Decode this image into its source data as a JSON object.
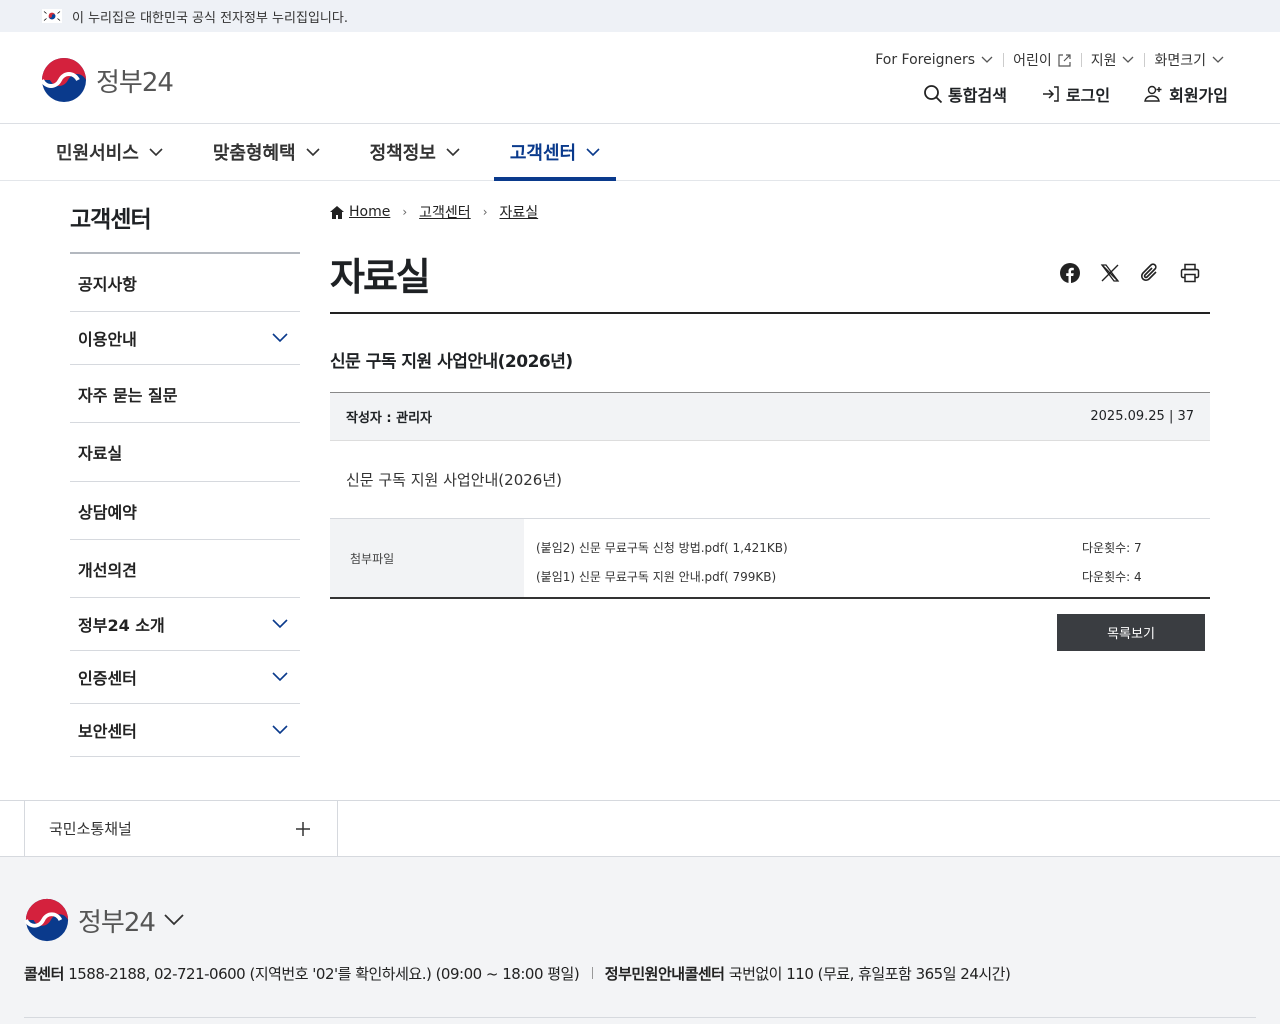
{
  "topbar": {
    "notice": "이 누리집은 대한민국 공식 전자정부 누리집입니다."
  },
  "header": {
    "logo_text": "정부24",
    "util": [
      "For Foreigners",
      "어린이",
      "지원",
      "화면크기"
    ],
    "actions": [
      {
        "label": "통합검색",
        "icon": "search-icon"
      },
      {
        "label": "로그인",
        "icon": "login-icon"
      },
      {
        "label": "회원가입",
        "icon": "user-add-icon"
      }
    ]
  },
  "gnb": [
    "민원서비스",
    "맞춤형혜택",
    "정책정보",
    "고객센터"
  ],
  "lnb": {
    "title": "고객센터",
    "items": [
      {
        "label": "공지사항",
        "expandable": false
      },
      {
        "label": "이용안내",
        "expandable": true
      },
      {
        "label": "자주 묻는 질문",
        "expandable": false
      },
      {
        "label": "자료실",
        "expandable": false
      },
      {
        "label": "상담예약",
        "expandable": false
      },
      {
        "label": "개선의견",
        "expandable": false
      },
      {
        "label": "정부24 소개",
        "expandable": true
      },
      {
        "label": "인증센터",
        "expandable": true
      },
      {
        "label": "보안센터",
        "expandable": true
      }
    ]
  },
  "breadcrumb": [
    "Home",
    "고객센터",
    "자료실"
  ],
  "page_title": "자료실",
  "post": {
    "title": "신문 구독 지원 사업안내(2026년)",
    "author": "작성자 : 관리자",
    "date_views": "2025.09.25 | 37",
    "content": "신문 구독 지원 사업안내(2026년)",
    "attach_label": "첨부파일",
    "files": [
      {
        "name": "(붙임2) 신문 무료구독 신청 방법.pdf( 1,421KB)",
        "downloads": "다운횟수: 7"
      },
      {
        "name": "(붙임1) 신문 무료구독 지원 안내.pdf( 799KB)",
        "downloads": "다운횟수: 4"
      }
    ],
    "list_button": "목록보기"
  },
  "footer": {
    "channel": "국민소통채널",
    "logo_text": "정부24",
    "call_label": "콜센터",
    "call_info": "1588-2188, 02-721-0600 (지역번호 '02'를 확인하세요.) (09:00 ~ 18:00 평일)",
    "gov_label": "정부민원안내콜센터",
    "gov_info": "국번없이 110 (무료, 휴일포함 365일 24시간)"
  },
  "colors": {
    "primary": "#0a3a8c",
    "accent_red": "#d4213d",
    "button_dark": "#3a3d41"
  }
}
